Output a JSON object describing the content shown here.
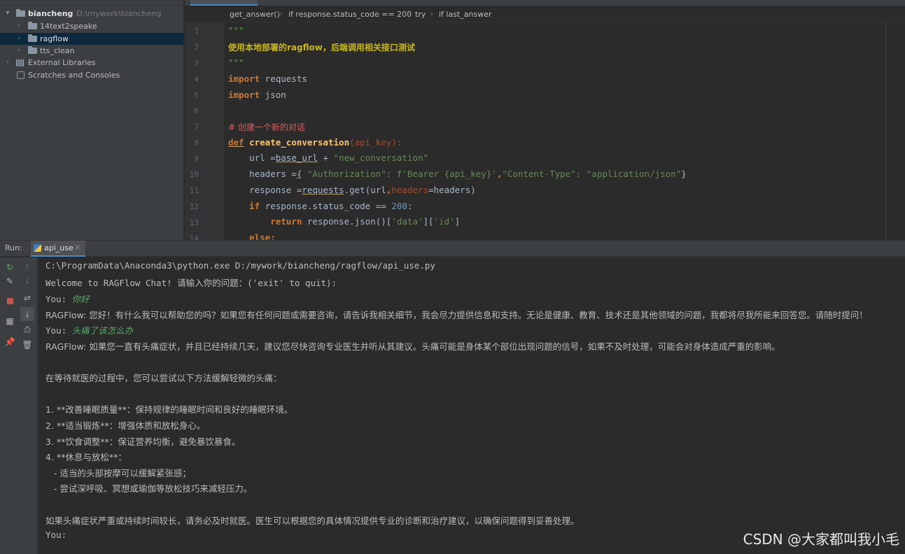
{
  "project": {
    "root_name": "biancheng",
    "root_path": "D:\\mywork\\biancheng",
    "items": [
      {
        "label": "14text2speake",
        "expanded": false,
        "selected": false
      },
      {
        "label": "ragflow",
        "expanded": false,
        "selected": true
      },
      {
        "label": "tts_clean",
        "expanded": false,
        "selected": false
      }
    ],
    "external_libraries": "External Libraries",
    "scratches": "Scratches and Consoles"
  },
  "breadcrumb": [
    "get_answer()",
    "if response.status_code == 200",
    "try",
    "if last_answer"
  ],
  "code": {
    "line_numbers": [
      "1",
      "2",
      "3",
      "4",
      "5",
      "6",
      "7",
      "8",
      "9",
      "10",
      "11",
      "12",
      "13",
      "14"
    ],
    "docstring_open": "\"\"\"",
    "docstring_text": "使用本地部署的ragflow，后端调用相关接口测试",
    "docstring_close": "\"\"\"",
    "kw_import": "import",
    "mod_requests": " requests",
    "mod_json": " json",
    "comment": "# 创建一个新的对话",
    "kw_def": "def",
    "func_name": "create_conversation",
    "func_params": "(api_key):",
    "line9_a": "    url =",
    "line9_b": "base_url",
    "line9_c": " + ",
    "line9_d": "\"new_conversation\"",
    "line10_a": "    headers =",
    "line10_b": "{",
    "line10_c": " \"Authorization\": f'Bearer {api_key}'",
    "line10_d": ",",
    "line10_e": "\"Content-Type\": \"application/json\"",
    "line10_f": "}",
    "line11_a": "    response =",
    "line11_b": "requests",
    "line11_c": ".get(url",
    "line11_d": ",",
    "line11_e": "headers",
    "line11_f": "=headers)",
    "line12_a": "    ",
    "kw_if": "if",
    "line12_b": " response.status_code == ",
    "line12_num": "200",
    "line12_c": ":",
    "line13_a": "        ",
    "kw_return": "return",
    "line13_b": " response.json()[",
    "line13_s1": "'data'",
    "line13_c": "][",
    "line13_s2": "'id'",
    "line13_d": "]",
    "line14_a": "    ",
    "kw_else": "else:"
  },
  "run": {
    "title": "Run:",
    "tab_label": "api_use",
    "tab_close": "×",
    "command": "C:\\ProgramData\\Anaconda3\\python.exe D:/mywork/biancheng/ragflow/api_use.py",
    "welcome": "Welcome to RAGFlow Chat! 请输入你的问题：('exit' to quit):",
    "you_prefix": "You: ",
    "input1": "你好",
    "reply1": "RAGFlow: 您好！有什么我可以帮助您的吗？如果您有任何问题或需要咨询，请告诉我相关细节，我会尽力提供信息和支持。无论是健康、教育、技术还是其他领域的问题，我都将尽我所能来回答您。请随时提问！",
    "input2": "头痛了该怎么办",
    "reply2": "RAGFlow: 如果您一直有头痛症状，并且已经持续几天，建议您尽快咨询专业医生并听从其建议。头痛可能是身体某个部位出现问题的信号，如果不及时处理，可能会对身体造成严重的影响。",
    "para1": "在等待就医的过程中，您可以尝试以下方法缓解轻微的头痛：",
    "list": [
      "1. **改善睡眠质量**：保持规律的睡眠时间和良好的睡眠环境。",
      "2. **适当锻炼**：增强体质和放松身心。",
      "3. **饮食调整**：保证营养均衡，避免暴饮暴食。",
      "4. **休息与放松**："
    ],
    "sub_list": [
      "   - 适当的头部按摩可以缓解紧张感；",
      "   - 尝试深呼吸、冥想或瑜伽等放松技巧来减轻压力。"
    ],
    "para2": "如果头痛症状严重或持续时间较长，请务必及时就医。医生可以根据您的具体情况提供专业的诊断和治疗建议，以确保问题得到妥善处理。",
    "prompt": "You:"
  },
  "watermark": "CSDN @大家都叫我小毛"
}
